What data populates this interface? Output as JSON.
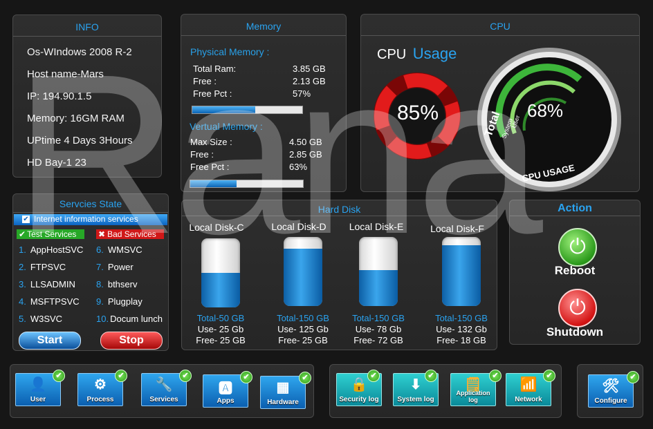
{
  "info": {
    "title": "INFO",
    "os": "Os-WIndows 2008 R-2",
    "host": "Host name-Mars",
    "ip": "IP: 194.90.1.5",
    "memory": "Memory: 16GM RAM",
    "uptime": "UPtime 4 Days 3Hours",
    "hd": "HD Bay-1 23"
  },
  "memory": {
    "title": "Memory",
    "physical_label": "Physical Memory :",
    "physical": [
      {
        "k": "Total Ram:",
        "v": "3.85 GB"
      },
      {
        "k": "Free :",
        "v": "2.13 GB"
      },
      {
        "k": "Free Pct :",
        "v": "57%"
      }
    ],
    "physical_fill_pct": 57,
    "virtual_label": "Vertual Memory :",
    "virtual": [
      {
        "k": "Max Size :",
        "v": "4.50 GB"
      },
      {
        "k": "Free :",
        "v": "2.85 GB"
      },
      {
        "k": "Free Pct :",
        "v": "63%"
      }
    ],
    "virtual_fill_pct": 41
  },
  "cpu": {
    "title": "CPU",
    "heading_cpu": "CPU",
    "heading_usage": "Usage",
    "ring_value": "85%",
    "gauge_value": "68%",
    "gauge_caption": "CPU USAGE",
    "gauge_total": "Total",
    "gauge_system": "System",
    "gauge_user": "User"
  },
  "services": {
    "title": "Servcies State",
    "header": "Internet information services",
    "test_label": "Test Services",
    "bad_label": "Bad Services",
    "left": [
      {
        "n": "1.",
        "name": "AppHostSVC"
      },
      {
        "n": "2.",
        "name": "FTPSVC"
      },
      {
        "n": "3.",
        "name": "LLSADMIN"
      },
      {
        "n": "4.",
        "name": "MSFTPSVC"
      },
      {
        "n": "5.",
        "name": "W3SVC"
      }
    ],
    "right": [
      {
        "n": "6.",
        "name": "WMSVC"
      },
      {
        "n": "7.",
        "name": "Power"
      },
      {
        "n": "8.",
        "name": "bthserv"
      },
      {
        "n": "9.",
        "name": "Plugplay"
      },
      {
        "n": "10.",
        "name": "Docum lunch"
      }
    ],
    "start_label": "Start",
    "stop_label": "Stop"
  },
  "disks": {
    "title": "Hard Disk",
    "items": [
      {
        "name": "Local Disk-C",
        "total": "Total-50 GB",
        "use": "Use- 25 Gb",
        "free": "Free- 25 GB",
        "fill": 0.5
      },
      {
        "name": "Local Disk-D",
        "total": "Total-150 GB",
        "use": "Use- 125 Gb",
        "free": "Free- 25 GB",
        "fill": 0.83
      },
      {
        "name": "Local Disk-E",
        "total": "Total-150 GB",
        "use": "Use- 78 Gb",
        "free": "Free- 72 GB",
        "fill": 0.52
      },
      {
        "name": "Local Disk-F",
        "total": "Total-150 GB",
        "use": "Use- 132 Gb",
        "free": "Free- 18 GB",
        "fill": 0.88
      }
    ]
  },
  "action": {
    "title": "Action",
    "reboot": "Reboot",
    "shutdown": "Shutdown"
  },
  "toolbar": {
    "user": "User",
    "process": "Process",
    "services": "Services",
    "apps": "Apps",
    "hardware": "Hardware",
    "security_log": "Security log",
    "system_log": "System log",
    "application_log": "Application log",
    "network": "Network",
    "configure": "Configure"
  },
  "watermark": "Rana",
  "colors": {
    "accent": "#2aa3f0",
    "good": "#2d9a1a",
    "bad": "#d01818"
  }
}
